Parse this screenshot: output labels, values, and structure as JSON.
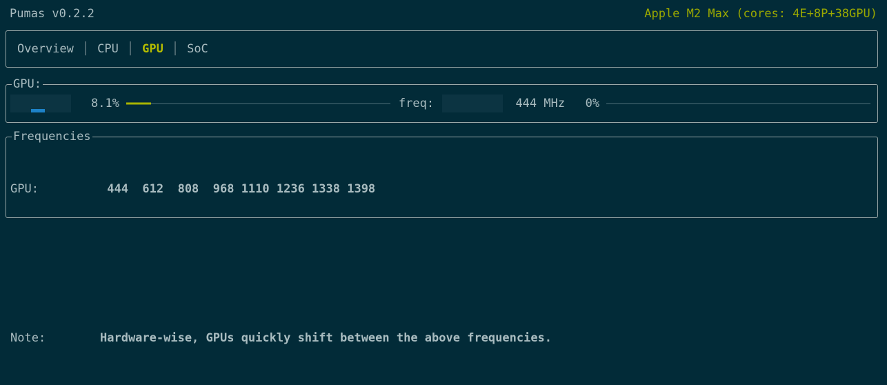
{
  "header": {
    "app_title": "Pumas v0.2.2",
    "chip_info": "Apple M2 Max (cores: 4E+8P+38GPU)",
    "accent_color": "#9aa800"
  },
  "tabs": {
    "items": [
      {
        "label": "Overview",
        "active": false
      },
      {
        "label": "CPU",
        "active": false
      },
      {
        "label": "GPU",
        "active": true
      },
      {
        "label": "SoC",
        "active": false
      }
    ],
    "separator": "│",
    "active_color": "#b5bd00"
  },
  "gpu_panel": {
    "legend": "GPU:",
    "usage": {
      "sparkline_name": "gpu-usage-sparkline",
      "value_label": "8.1%",
      "percent": 8.1,
      "bar_color": "#1d82c7",
      "gauge_color": "#a8b400"
    },
    "frequency": {
      "label": "freq:",
      "sparkline_name": "gpu-freq-sparkline",
      "value_label": "444 MHz",
      "percent_label": "0%",
      "percent": 0
    }
  },
  "frequencies_panel": {
    "legend": "Frequencies",
    "gpu_row_label": "GPU:",
    "gpu_values": [
      444,
      612,
      808,
      968,
      1110,
      1236,
      1338,
      1398
    ],
    "gpu_values_text": " 444  612  808  968 1110 1236 1338 1398",
    "note_label": "Note:",
    "note_text": "Hardware-wise, GPUs quickly shift between the above frequencies."
  },
  "theme": {
    "background": "#022b38",
    "foreground": "#a9bcc0",
    "border": "#9aa8a8",
    "sparkbox_bg": "#0c3442",
    "track": "#4e6f78"
  }
}
